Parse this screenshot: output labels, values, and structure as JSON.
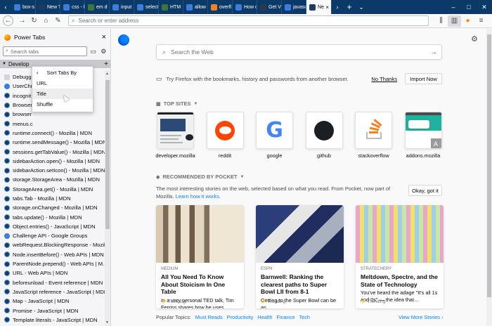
{
  "tabs": [
    {
      "label": "box-s",
      "fav": "#3b7ddd"
    },
    {
      "label": "New T",
      "fav": "#1b3b63"
    },
    {
      "label": "css - l",
      "fav": "#3b7ddd"
    },
    {
      "label": "em d",
      "fav": "#3c763d"
    },
    {
      "label": "input",
      "fav": "#3b7ddd"
    },
    {
      "label": "select",
      "fav": "#3b7ddd"
    },
    {
      "label": "HTM",
      "fav": "#3c763d"
    },
    {
      "label": "allow",
      "fav": "#3b7ddd"
    },
    {
      "label": "overfl",
      "fav": "#f48024"
    },
    {
      "label": "How c",
      "fav": "#3b7ddd"
    },
    {
      "label": "Get V",
      "fav": "#2b3a4a"
    },
    {
      "label": "javasc",
      "fav": "#3b7ddd"
    },
    {
      "label": "Ne",
      "fav": "#1b3b63",
      "active": true
    }
  ],
  "urlbar": {
    "placeholder": "Search or enter address"
  },
  "sidebar": {
    "title": "Power Tabs",
    "search_placeholder": "Search tabs",
    "group_label": "Develop",
    "items": [
      {
        "label": "Debugg",
        "fav": "dbg"
      },
      {
        "label": "UserChr",
        "fav": "g"
      },
      {
        "label": "incognit",
        "fav": "mdn"
      },
      {
        "label": "Browser",
        "fav": "mdn"
      },
      {
        "label": "browser",
        "fav": "mdn"
      },
      {
        "label": "menus.c",
        "fav": "mdn"
      },
      {
        "label": "runtime.connect() - Mozilla | MDN",
        "fav": "mdn"
      },
      {
        "label": "runtime.sendMessage() - Mozilla | MDN",
        "fav": "mdn"
      },
      {
        "label": "sessions.getTabValue() - Mozilla | MDN",
        "fav": "mdn"
      },
      {
        "label": "sidebarAction.open() - Mozilla | MDN",
        "fav": "mdn"
      },
      {
        "label": "sidebarAction.setIcon() - Mozilla | MDN",
        "fav": "mdn"
      },
      {
        "label": "storage.StorageArea - Mozilla | MDN",
        "fav": "mdn"
      },
      {
        "label": "StorageArea.get() - Mozilla | MDN",
        "fav": "mdn"
      },
      {
        "label": "tabs.Tab - Mozilla | MDN",
        "fav": "mdn"
      },
      {
        "label": "storage.onChanged - Mozilla | MDN",
        "fav": "mdn"
      },
      {
        "label": "tabs.update() - Mozilla | MDN",
        "fav": "mdn"
      },
      {
        "label": "Object.entries() - JavaScript | MDN",
        "fav": "mdn"
      },
      {
        "label": "Challenge API - Google Groups",
        "fav": "g"
      },
      {
        "label": "webRequest.BlockingResponse - Mozil...",
        "fav": "mdn"
      },
      {
        "label": "Node.insertBefore() - Web APIs | MDN",
        "fav": "mdn"
      },
      {
        "label": "ParentNode.prepend() - Web APIs | M...",
        "fav": "mdn"
      },
      {
        "label": "URL - Web APIs | MDN",
        "fav": "mdn"
      },
      {
        "label": "beforeunload - Event reference | MDN",
        "fav": "mdn"
      },
      {
        "label": "JavaScript reference - JavaScript | MDN",
        "fav": "mdn"
      },
      {
        "label": "Map - JavaScript | MDN",
        "fav": "mdn"
      },
      {
        "label": "Promise - JavaScript | MDN",
        "fav": "mdn"
      },
      {
        "label": "Template literals - JavaScript | MDN",
        "fav": "mdn"
      }
    ]
  },
  "sort_menu": {
    "title": "Sort Tabs By",
    "options": [
      "URL",
      "Title",
      "Shuffle"
    ]
  },
  "newtab": {
    "search_placeholder": "Search the Web",
    "snippet_text": "Try Firefox with the bookmarks, history and passwords from another browser.",
    "no_thanks": "No Thanks",
    "import_now": "Import Now",
    "top_sites_label": "TOP SITES",
    "top_sites": [
      "developer.mozilla",
      "reddit",
      "google",
      "github",
      "stackoverflow",
      "addons.mozilla"
    ],
    "pocket_label": "RECOMMENDED BY POCKET",
    "pocket_desc": "The most interesting stories on the web, selected based on what you read. From Pocket, now part of Mozilla.",
    "pocket_link": "Learn how it works.",
    "okay_got_it": "Okay, got it",
    "cards": [
      {
        "source": "MEDIUM",
        "title": "All You Need To Know About Stoicism In One Table",
        "excerpt": "In a very personal TED talk, Tim Ferriss shares how he uses...",
        "trend": "Trending"
      },
      {
        "source": "ESPN",
        "title": "Barnwell: Ranking the clearest paths to Super Bowl LII from 8-1",
        "excerpt": "Getting to the Super Bowl can be as...",
        "trend": "Trending"
      },
      {
        "source": "STRATECHERY",
        "title": "Meltdown, Spectre, and the State of Technology",
        "excerpt": "You've heard the adage \"It's all 1s and 0s\" — the idea that...",
        "trend": "Trending"
      }
    ],
    "popular_label": "Popular Topics:",
    "topics": [
      "Must Reads",
      "Productivity",
      "Health",
      "Finance",
      "Tech"
    ],
    "view_more": "View More Stories"
  }
}
